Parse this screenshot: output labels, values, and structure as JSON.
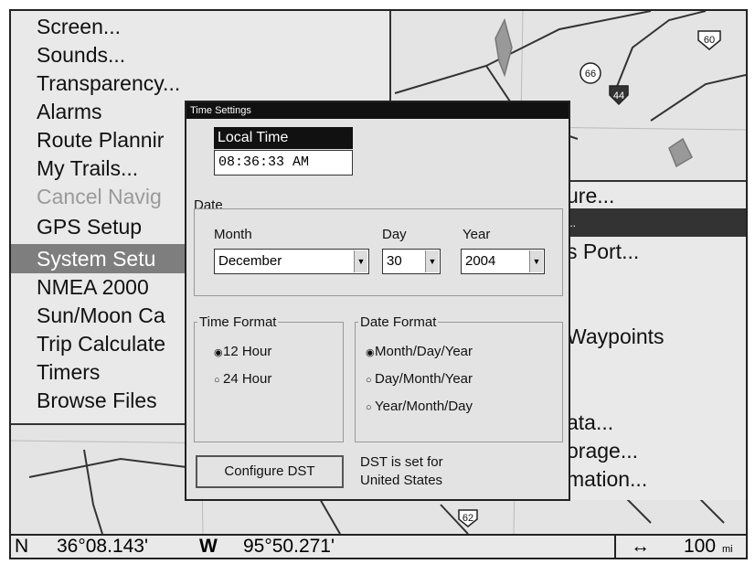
{
  "main_menu": {
    "items": [
      {
        "label": "Screen..."
      },
      {
        "label": "Sounds..."
      },
      {
        "label": "Transparency..."
      },
      {
        "label": "Alarms"
      },
      {
        "label": "Route Plannir"
      },
      {
        "label": "My Trails..."
      },
      {
        "label": "Cancel Navig"
      },
      {
        "label": "GPS Setup"
      },
      {
        "label": "System Setu"
      },
      {
        "label": "NMEA 2000"
      },
      {
        "label": "Sun/Moon Ca"
      },
      {
        "label": "Trip Calculate"
      },
      {
        "label": "Timers"
      },
      {
        "label": "Browse Files"
      }
    ],
    "selected_index": 8,
    "disabled_index": 6
  },
  "sub_menu": {
    "items": [
      {
        "label": "ure..."
      },
      {
        "label": "..."
      },
      {
        "label": "s Port..."
      },
      {
        "label": "Waypoints"
      },
      {
        "label": "ata..."
      },
      {
        "label": "orage..."
      },
      {
        "label": "mation..."
      }
    ],
    "selected_index": 1
  },
  "dialog": {
    "title": "Time Settings",
    "local_time_label": "Local Time",
    "local_time_value": "08:36:33  AM",
    "date_group_label": "Date",
    "month_label": "Month",
    "month_value": "December",
    "day_label": "Day",
    "day_value": "30",
    "year_label": "Year",
    "year_value": "2004",
    "time_format_label": "Time Format",
    "time_format_options": [
      "12 Hour",
      "24 Hour"
    ],
    "time_format_selected": "12 Hour",
    "date_format_label": "Date Format",
    "date_format_options": [
      "Month/Day/Year",
      "Day/Month/Year",
      "Year/Month/Day"
    ],
    "date_format_selected": "Month/Day/Year",
    "configure_dst_label": "Configure DST",
    "dst_status_line1": "DST is set for",
    "dst_status_line2": "United States"
  },
  "status_bar": {
    "lat_hemisphere": "N",
    "lat_value": "36°08.143'",
    "lon_hemisphere": "W",
    "lon_value": "95°50.271'",
    "range_icon": "horizontal-double-arrow",
    "range_value": "100",
    "range_unit": "mi"
  },
  "map": {
    "road_labels": [
      "60",
      "66",
      "44",
      "62"
    ]
  }
}
